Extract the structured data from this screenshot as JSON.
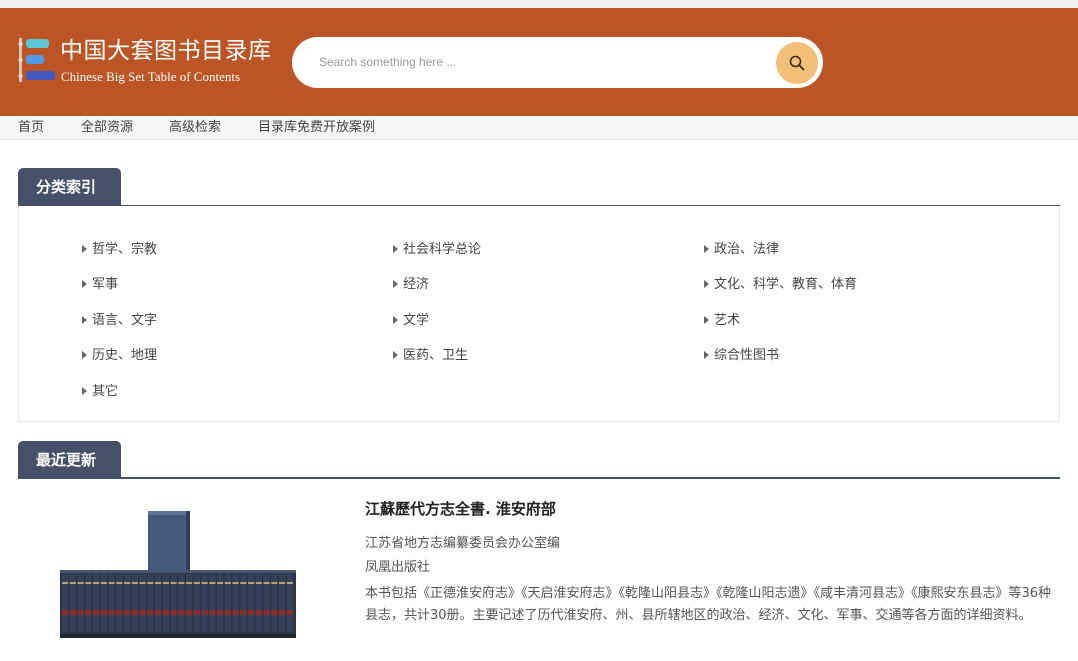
{
  "header": {
    "logo_title": "中国大套图书目录库",
    "logo_subtitle": "Chinese Big Set Table of Contents",
    "search_placeholder": "Search something here ...",
    "accent_color": "#bb5526",
    "search_button_color": "#f3c079",
    "icons": {
      "logo": "book-list-logo-icon",
      "search": "search-icon"
    }
  },
  "nav": {
    "items": [
      "首页",
      "全部资源",
      "高级检索",
      "目录库免费开放案例"
    ]
  },
  "category_index": {
    "title": "分类索引",
    "items": [
      "哲学、宗教",
      "社会科学总论",
      "政治、法律",
      "军事",
      "经济",
      "文化、科学、教育、体育",
      "语言、文字",
      "文学",
      "艺术",
      "历史、地理",
      "医药、卫生",
      "综合性图书",
      "其它"
    ]
  },
  "recent_updates": {
    "title": "最近更新",
    "book": {
      "title": "江蘇歷代方志全書. 淮安府部",
      "editor": "江苏省地方志编纂委员会办公室编",
      "publisher": "凤凰出版社",
      "description": "本书包括《正德淮安府志》《天启淮安府志》《乾隆山阳县志》《乾隆山阳志遗》《咸丰清河县志》《康熙安东县志》等36种县志，共计30册。主要记述了历代淮安府、州、县所辖地区的政治、经济、文化、军事、交通等各方面的详细资料。"
    }
  },
  "section_tab_color": "#455168"
}
